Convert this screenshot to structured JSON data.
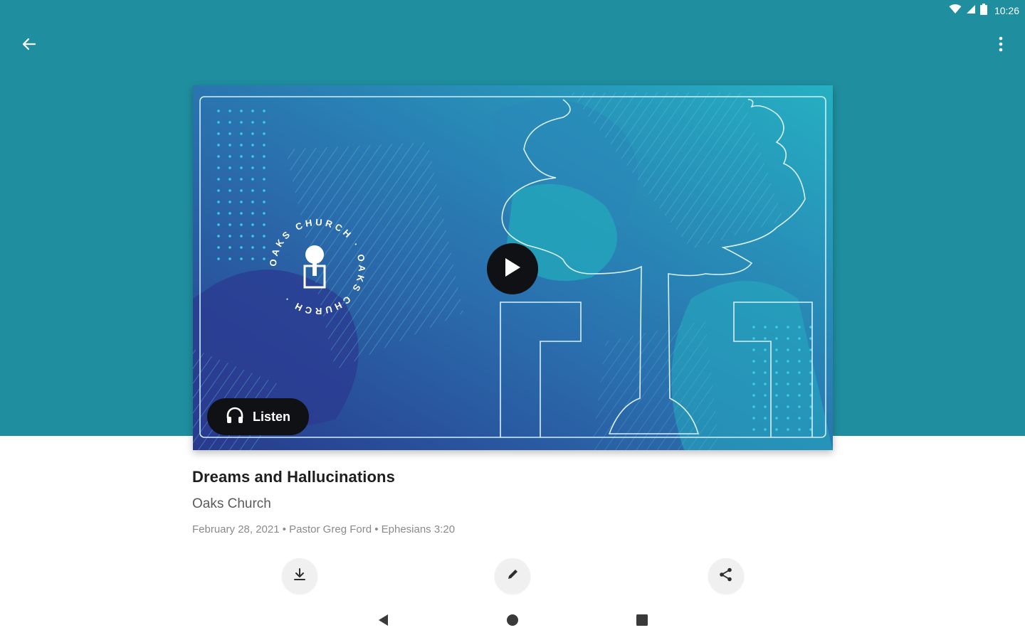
{
  "status_bar": {
    "time": "10:26",
    "icons": [
      "wifi-icon",
      "cell-signal-icon",
      "battery-icon"
    ]
  },
  "toolbar": {
    "back_icon": "arrow-back-icon",
    "menu_icon": "more-vert-icon"
  },
  "media": {
    "brand_ring_text": "OAKS CHURCH · OAKS CHURCH ·",
    "play_icon": "play-icon",
    "listen_label": "Listen",
    "listen_icon": "headphones-icon"
  },
  "sermon": {
    "title": "Dreams and Hallucinations",
    "church": "Oaks Church",
    "meta": "February 28, 2021 • Pastor Greg Ford • Ephesians 3:20"
  },
  "actions": [
    {
      "name": "download",
      "icon": "download-icon"
    },
    {
      "name": "edit",
      "icon": "pencil-icon"
    },
    {
      "name": "share",
      "icon": "share-icon"
    }
  ],
  "nav": {
    "back_icon": "nav-back-icon",
    "home_icon": "nav-home-icon",
    "recents_icon": "nav-recents-icon"
  },
  "colors": {
    "header": "#1f8e9e",
    "card_dark": "#2a3f8f",
    "card_light": "#23a9bd",
    "button_dark": "#0f1114"
  }
}
